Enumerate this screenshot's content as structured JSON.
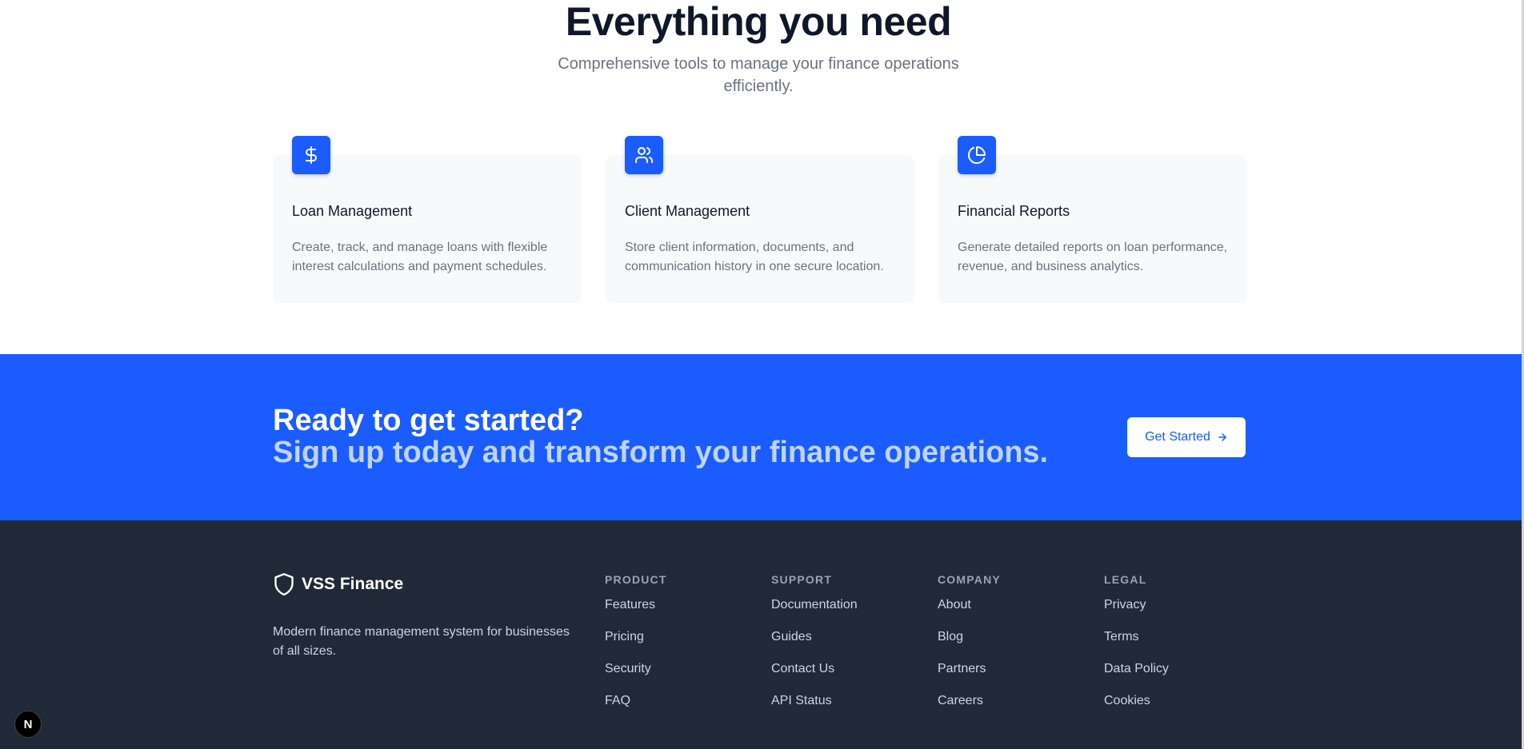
{
  "features": {
    "title": "Everything you need",
    "subtitle": "Comprehensive tools to manage your finance operations efficiently.",
    "cards": [
      {
        "icon": "dollar-icon",
        "title": "Loan Management",
        "description": "Create, track, and manage loans with flexible interest calculations and payment schedules."
      },
      {
        "icon": "users-icon",
        "title": "Client Management",
        "description": "Store client information, documents, and communication history in one secure location."
      },
      {
        "icon": "pie-chart-icon",
        "title": "Financial Reports",
        "description": "Generate detailed reports on loan performance, revenue, and business analytics."
      }
    ]
  },
  "cta": {
    "line1": "Ready to get started?",
    "line2": "Sign up today and transform your finance operations.",
    "button_label": "Get Started",
    "button_icon": "arrow-right-icon"
  },
  "footer": {
    "brand_name": "VSS Finance",
    "brand_icon": "shield-icon",
    "brand_description": "Modern finance management system for businesses of all sizes.",
    "columns": [
      {
        "heading": "PRODUCT",
        "links": [
          "Features",
          "Pricing",
          "Security",
          "FAQ"
        ]
      },
      {
        "heading": "SUPPORT",
        "links": [
          "Documentation",
          "Guides",
          "Contact Us",
          "API Status"
        ]
      },
      {
        "heading": "COMPANY",
        "links": [
          "About",
          "Blog",
          "Partners",
          "Careers"
        ]
      },
      {
        "heading": "LEGAL",
        "links": [
          "Privacy",
          "Terms",
          "Data Policy",
          "Cookies"
        ]
      }
    ]
  },
  "dev_badge": {
    "label": "N",
    "icon": "nextjs-icon"
  },
  "colors": {
    "accent": "#1a5cff",
    "cta_secondary_text": "#bfd5ff",
    "footer_bg": "#1f2937",
    "card_bg": "#f8f9fb"
  }
}
